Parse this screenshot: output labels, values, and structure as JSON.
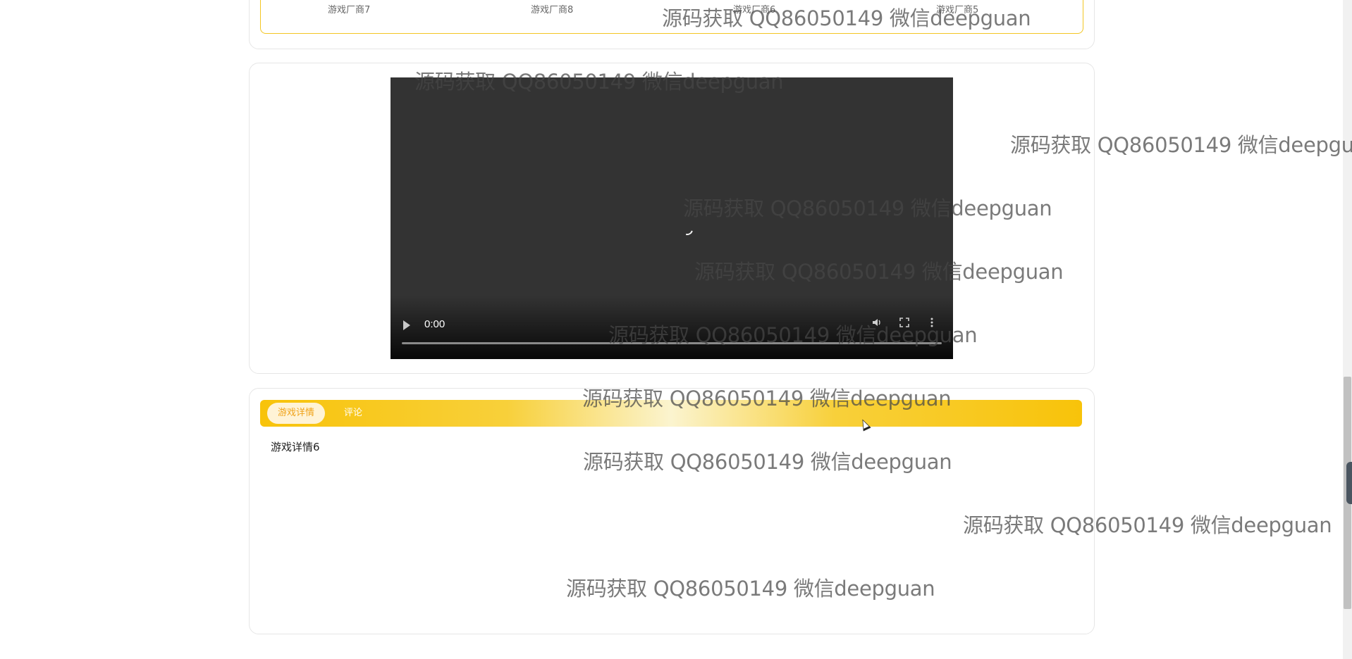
{
  "vendors": {
    "items": [
      "游戏厂商7",
      "游戏厂商8",
      "游戏厂商6",
      "游戏厂商5"
    ]
  },
  "video": {
    "current_time": "0:00",
    "progress": 0,
    "controls": {
      "play_icon": "play-icon",
      "volume_icon": "volume-icon",
      "fullscreen_icon": "fullscreen-icon",
      "more_icon": "more-options-icon"
    }
  },
  "detail": {
    "tabs": [
      {
        "label": "游戏详情",
        "active": true
      },
      {
        "label": "评论",
        "active": false
      }
    ],
    "content": "游戏详情6"
  },
  "watermark": {
    "text": "源码获取 QQ86050149 微信deepguan"
  },
  "colors": {
    "accent": "#f8c30a",
    "tab_active_text": "#f0a31a",
    "video_bg": "#333333"
  }
}
